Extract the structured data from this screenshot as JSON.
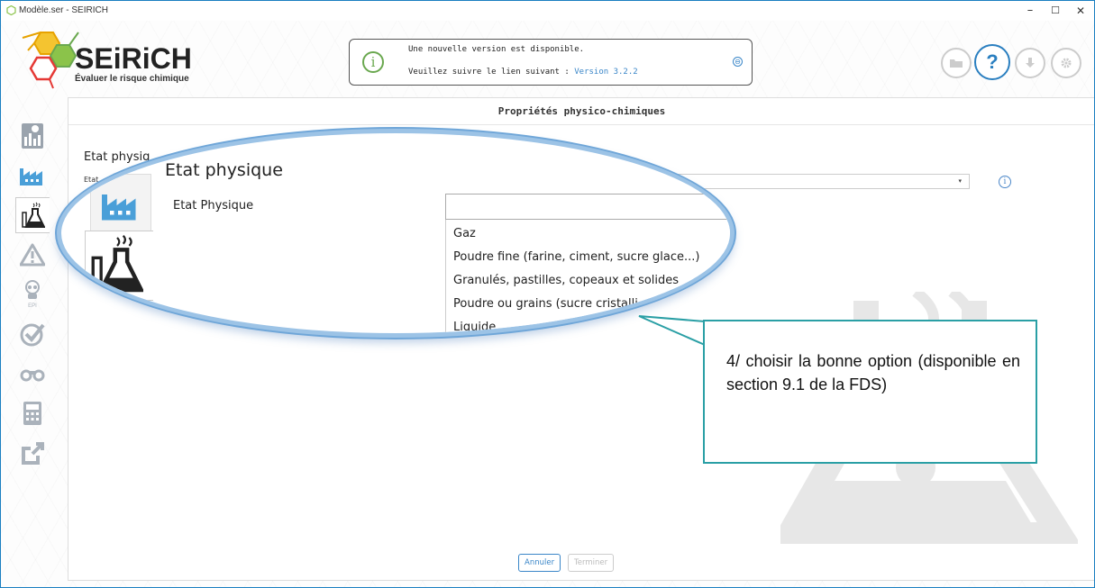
{
  "window": {
    "title": "Modèle.ser - SEIRICH",
    "controls": {
      "minimize": "–",
      "maximize": "☐",
      "close": "✕"
    }
  },
  "header": {
    "brand": "SEiRiCH",
    "tagline": "Évaluer le risque chimique"
  },
  "notice": {
    "line1": "Une nouvelle version est disponible.",
    "line2_prefix": "Veuillez suivre le lien suivant : ",
    "link": "Version 3.2.2",
    "info_icon": "i",
    "close_icon": "⊖"
  },
  "toolbar": {
    "help_label": "?"
  },
  "rail": {
    "items": [
      "dashboard-icon",
      "factory-icon",
      "flask-icon",
      "warning-icon",
      "epi-icon",
      "check-icon",
      "binoculars-icon",
      "calculator-icon",
      "export-icon"
    ],
    "epi_label": "EPI"
  },
  "panel": {
    "title": "Propriétés physico-chimiques",
    "section_heading": "Etat physique",
    "field_label": "Etat Physique",
    "info_icon": "i",
    "caret": "▾",
    "options": [
      "Gaz",
      "Poudre fine (farine, ciment, sucre glace...)",
      "Granulés, pastilles, copeaux et solides",
      "Poudre ou grains (sucre cristalli",
      "Liquide"
    ],
    "buttons": {
      "cancel": "Annuler",
      "finish": "Terminer"
    },
    "clipped": {
      "heading": "Etat physiq",
      "label": "Etat"
    }
  },
  "annotation": {
    "text": "4/ choisir la bonne option (disponible en section 9.1 de la FDS)",
    "colors": {
      "border": "#2a9fa5"
    }
  },
  "colors": {
    "accent_blue": "#2a7fc0",
    "ring_blue": "#9cc3e6",
    "info_green": "#6aa84f",
    "link_blue": "#3a86c8"
  }
}
